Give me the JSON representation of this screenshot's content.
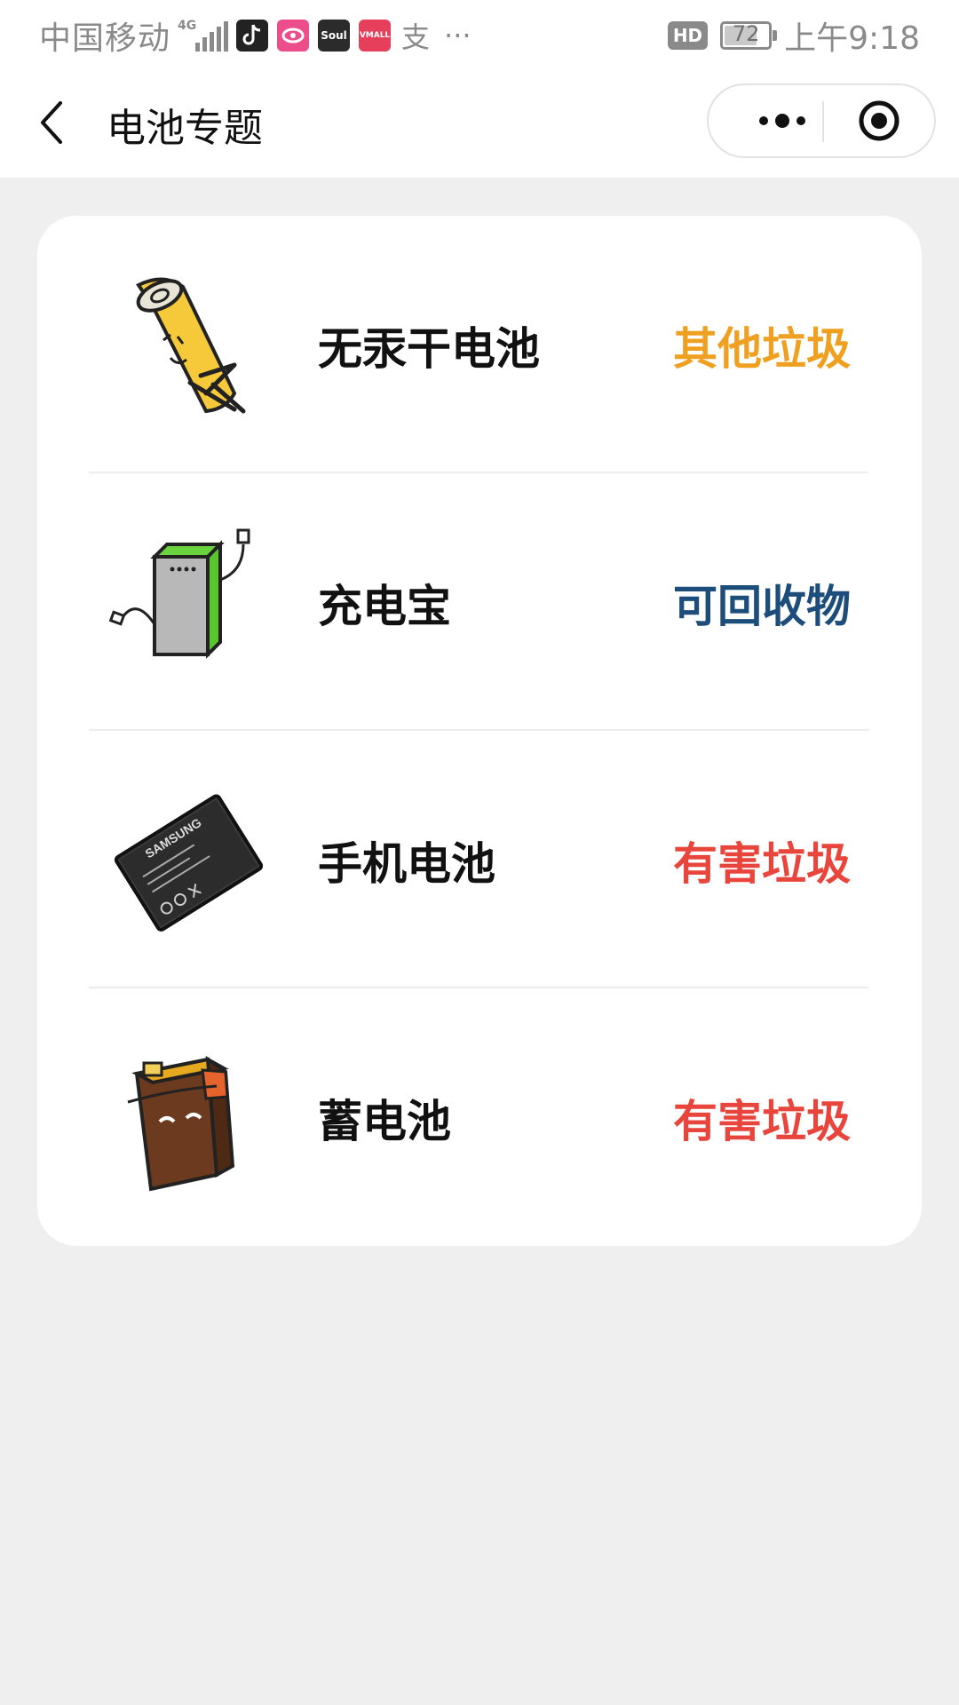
{
  "status_bar": {
    "carrier": "中国移动",
    "network": "4G",
    "hd_badge": "HD",
    "battery_level": "72",
    "time": "上午9:18",
    "notification_icons": [
      "tiktok-icon",
      "weibo-eye-icon",
      "soul-icon",
      "vmall-icon",
      "alipay-icon"
    ],
    "app_labels": [
      "Soul",
      "VMALL",
      "支"
    ],
    "more_indicator": "···"
  },
  "nav": {
    "title": "电池专题"
  },
  "colors": {
    "other_waste": "#f0a020",
    "recyclable": "#1d4d7a",
    "hazardous": "#e8453c"
  },
  "items": [
    {
      "name": "无汞干电池",
      "category": "其他垃圾",
      "icon": "aa-battery-icon",
      "category_color": "#f0a020"
    },
    {
      "name": "充电宝",
      "category": "可回收物",
      "icon": "power-bank-icon",
      "category_color": "#1d4d7a"
    },
    {
      "name": "手机电池",
      "category": "有害垃圾",
      "icon": "phone-battery-icon",
      "category_color": "#e8453c"
    },
    {
      "name": "蓄电池",
      "category": "有害垃圾",
      "icon": "storage-battery-icon",
      "category_color": "#e8453c"
    }
  ],
  "samsung_label": "SAMSUNG"
}
